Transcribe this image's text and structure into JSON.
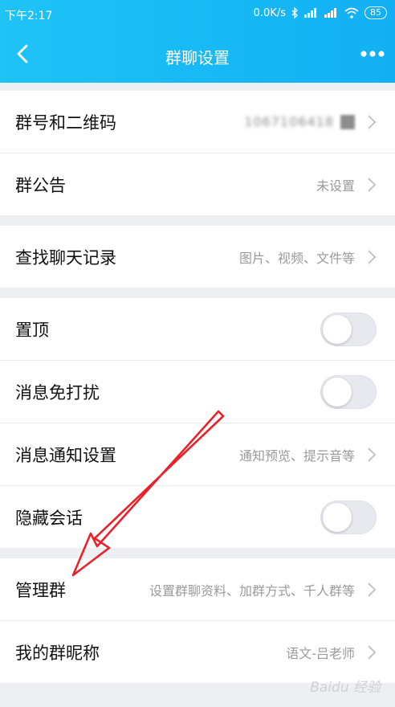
{
  "status_bar": {
    "time": "下午2:17",
    "network_speed": "0.0K/s",
    "battery": "85"
  },
  "header": {
    "title": "群聊设置"
  },
  "groups": [
    {
      "rows": [
        {
          "label": "群号和二维码",
          "value": "1067106418"
        },
        {
          "label": "群公告",
          "value": "未设置"
        }
      ]
    },
    {
      "rows": [
        {
          "label": "查找聊天记录",
          "value": "图片、视频、文件等"
        }
      ]
    },
    {
      "rows": [
        {
          "label": "置顶",
          "toggle": false
        },
        {
          "label": "消息免打扰",
          "toggle": false
        },
        {
          "label": "消息通知设置",
          "value": "通知预览、提示音等"
        },
        {
          "label": "隐藏会话",
          "toggle": false
        }
      ]
    },
    {
      "rows": [
        {
          "label": "管理群",
          "value": "设置群聊资料、加群方式、千人群等"
        },
        {
          "label": "我的群昵称",
          "value": "语文-吕老师"
        }
      ]
    }
  ],
  "watermark": "Baidu 经验",
  "colors": {
    "header": "#12b0f3",
    "annotation_arrow": "#e8222a"
  }
}
